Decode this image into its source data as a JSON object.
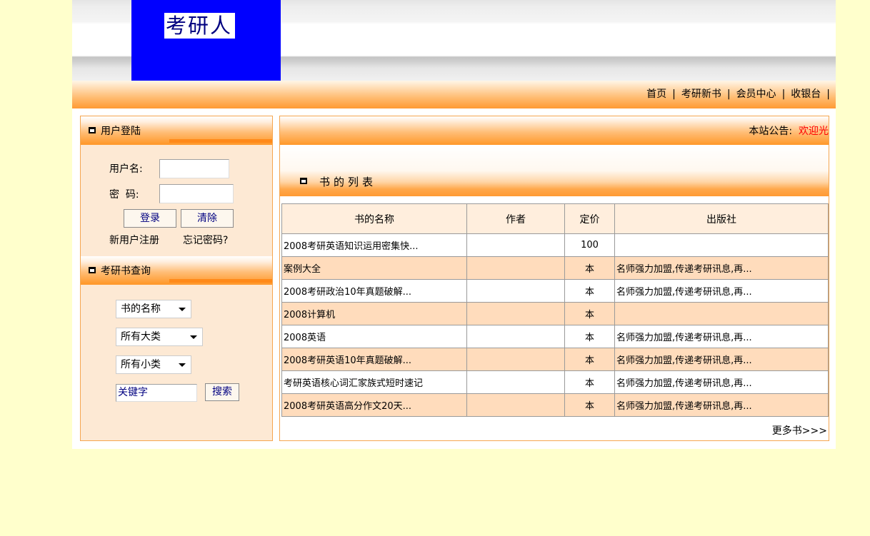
{
  "header": {
    "logo_text": "考研人"
  },
  "nav": {
    "links": [
      "首页",
      "考研新书",
      "会员中心",
      "收银台"
    ],
    "separator": "|"
  },
  "login": {
    "title": "用户登陆",
    "username_label": "用户名:",
    "password_label": "密  码:",
    "login_button": "登录",
    "clear_button": "清除",
    "register_link": "新用户注册",
    "forgot_link": "忘记密码?"
  },
  "search": {
    "title": "考研书查询",
    "field_select": "书的名称",
    "category_select": "所有大类",
    "subcategory_select": "所有小类",
    "keyword_value": "关键字",
    "search_button": "搜索"
  },
  "notice": {
    "label": "本站公告:",
    "text": "欢迎光"
  },
  "booklist": {
    "title": "书的列表",
    "columns": [
      "书的名称",
      "作者",
      "定价",
      "出版社"
    ],
    "rows": [
      {
        "name": "2008考研英语知识运用密集快...",
        "author": "",
        "price": "100",
        "publisher": ""
      },
      {
        "name": "案例大全",
        "author": "",
        "price": "本",
        "publisher": "名师强力加盟,传递考研讯息,再..."
      },
      {
        "name": "2008考研政治10年真题破解...",
        "author": "",
        "price": "本",
        "publisher": "名师强力加盟,传递考研讯息,再..."
      },
      {
        "name": "2008计算机",
        "author": "",
        "price": "本",
        "publisher": ""
      },
      {
        "name": "2008英语",
        "author": "",
        "price": "本",
        "publisher": "名师强力加盟,传递考研讯息,再..."
      },
      {
        "name": "2008考研英语10年真题破解...",
        "author": "",
        "price": "本",
        "publisher": "名师强力加盟,传递考研讯息,再..."
      },
      {
        "name": "考研英语核心词汇家族式短时速记",
        "author": "",
        "price": "本",
        "publisher": "名师强力加盟,传递考研讯息,再..."
      },
      {
        "name": "2008考研英语高分作文20天...",
        "author": "",
        "price": "本",
        "publisher": "名师强力加盟,传递考研讯息,再..."
      }
    ],
    "more_link": "更多书>>>"
  },
  "colors": {
    "page_bg": "#ffffcc",
    "logo_bg": "#0000ff",
    "accent": "#ff9a33",
    "row_alt": "#ffdcbc",
    "notice_red": "#ff0000"
  }
}
